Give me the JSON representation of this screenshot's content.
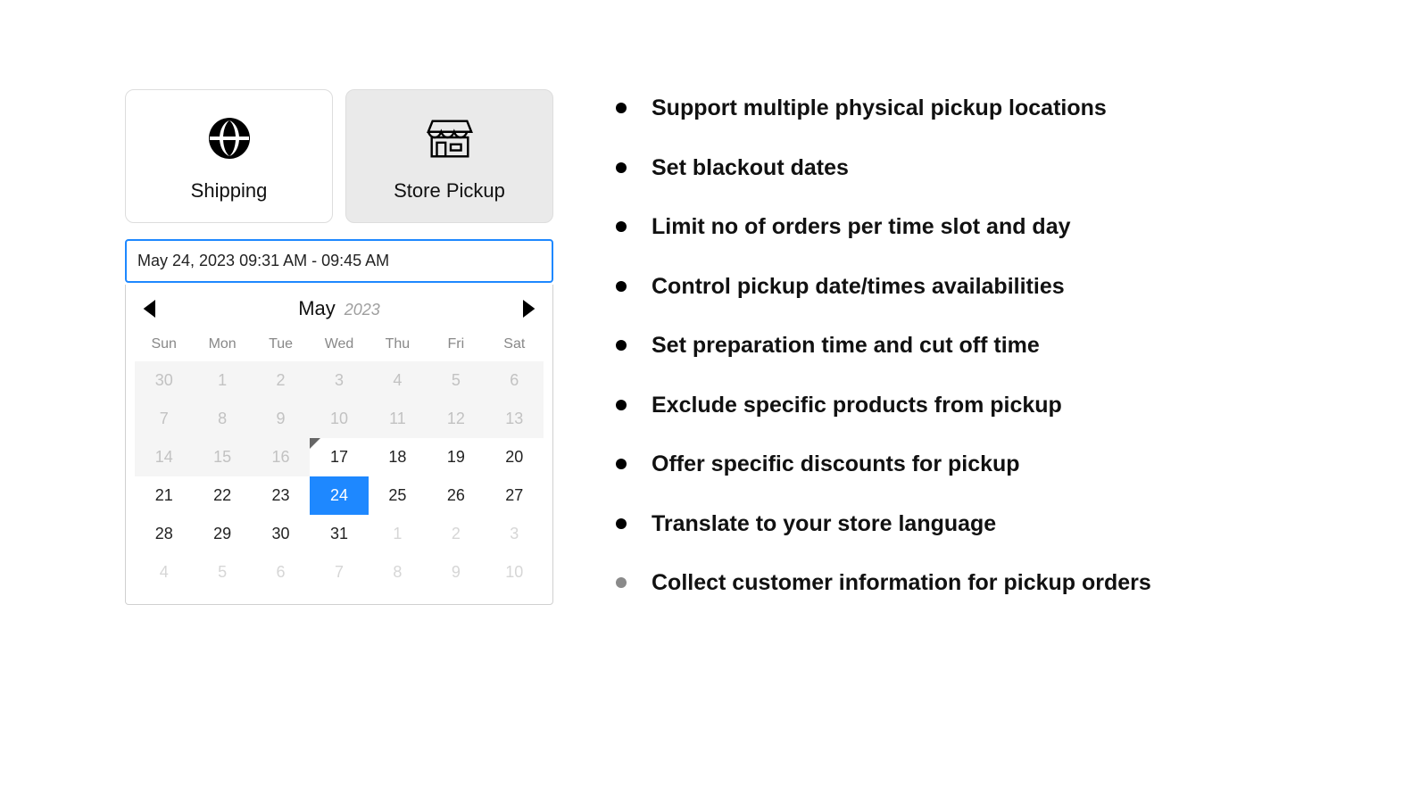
{
  "delivery": {
    "shipping_label": "Shipping",
    "pickup_label": "Store Pickup",
    "selected": "pickup"
  },
  "range_value": "May 24, 2023 09:31 AM - 09:45 AM",
  "calendar": {
    "month": "May",
    "year": "2023",
    "dows": [
      "Sun",
      "Mon",
      "Tue",
      "Wed",
      "Thu",
      "Fri",
      "Sat"
    ],
    "rows": [
      [
        {
          "n": "30",
          "state": "disabled"
        },
        {
          "n": "1",
          "state": "disabled"
        },
        {
          "n": "2",
          "state": "disabled"
        },
        {
          "n": "3",
          "state": "disabled"
        },
        {
          "n": "4",
          "state": "disabled"
        },
        {
          "n": "5",
          "state": "disabled"
        },
        {
          "n": "6",
          "state": "disabled"
        }
      ],
      [
        {
          "n": "7",
          "state": "disabled"
        },
        {
          "n": "8",
          "state": "disabled"
        },
        {
          "n": "9",
          "state": "disabled"
        },
        {
          "n": "10",
          "state": "disabled"
        },
        {
          "n": "11",
          "state": "disabled"
        },
        {
          "n": "12",
          "state": "disabled"
        },
        {
          "n": "13",
          "state": "disabled"
        }
      ],
      [
        {
          "n": "14",
          "state": "disabled"
        },
        {
          "n": "15",
          "state": "disabled"
        },
        {
          "n": "16",
          "state": "disabled"
        },
        {
          "n": "17",
          "state": "normal",
          "today": true
        },
        {
          "n": "18",
          "state": "normal"
        },
        {
          "n": "19",
          "state": "normal"
        },
        {
          "n": "20",
          "state": "normal"
        }
      ],
      [
        {
          "n": "21",
          "state": "normal"
        },
        {
          "n": "22",
          "state": "normal"
        },
        {
          "n": "23",
          "state": "normal"
        },
        {
          "n": "24",
          "state": "selected"
        },
        {
          "n": "25",
          "state": "normal"
        },
        {
          "n": "26",
          "state": "normal"
        },
        {
          "n": "27",
          "state": "normal"
        }
      ],
      [
        {
          "n": "28",
          "state": "normal"
        },
        {
          "n": "29",
          "state": "normal"
        },
        {
          "n": "30",
          "state": "normal"
        },
        {
          "n": "31",
          "state": "normal"
        },
        {
          "n": "1",
          "state": "out"
        },
        {
          "n": "2",
          "state": "out"
        },
        {
          "n": "3",
          "state": "out"
        }
      ],
      [
        {
          "n": "4",
          "state": "out"
        },
        {
          "n": "5",
          "state": "out"
        },
        {
          "n": "6",
          "state": "out"
        },
        {
          "n": "7",
          "state": "out"
        },
        {
          "n": "8",
          "state": "out"
        },
        {
          "n": "9",
          "state": "out"
        },
        {
          "n": "10",
          "state": "out"
        }
      ]
    ]
  },
  "features": [
    {
      "text": "Support multiple physical pickup locations",
      "muted": false
    },
    {
      "text": "Set blackout dates",
      "muted": false
    },
    {
      "text": "Limit no of orders per time slot and day",
      "muted": false
    },
    {
      "text": "Control pickup date/times availabilities",
      "muted": false
    },
    {
      "text": "Set preparation time and cut off time",
      "muted": false
    },
    {
      "text": "Exclude specific products from pickup",
      "muted": false
    },
    {
      "text": "Offer specific discounts for pickup",
      "muted": false
    },
    {
      "text": "Translate to your store language",
      "muted": false
    },
    {
      "text": "Collect customer information for pickup orders",
      "muted": true
    }
  ]
}
